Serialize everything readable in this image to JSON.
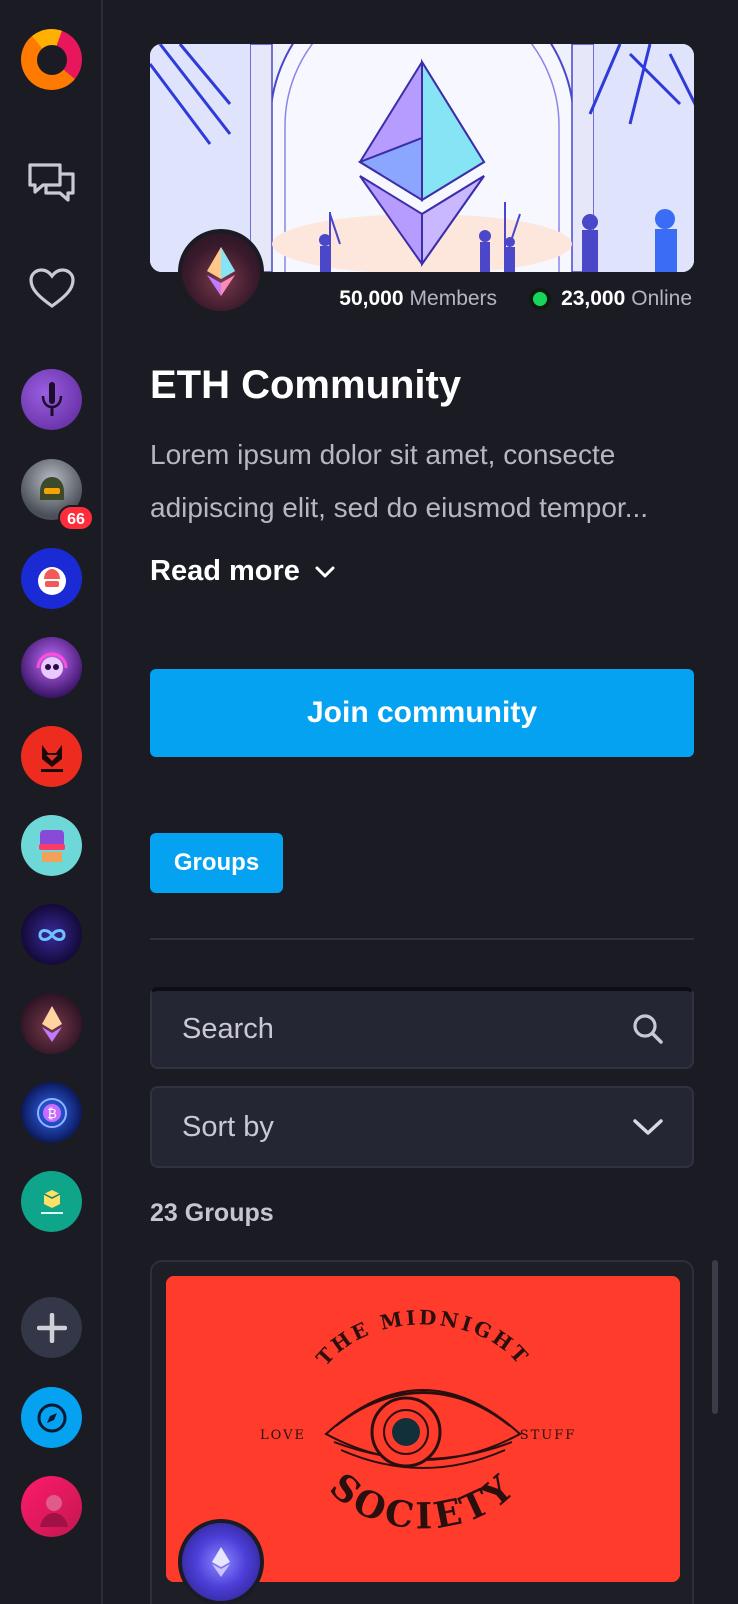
{
  "sidebar": {
    "logo": "app-logo",
    "nav": [
      {
        "name": "chat-icon"
      },
      {
        "name": "heart-icon"
      }
    ],
    "communities": [
      {
        "name": "community-purple-mic",
        "color": "#7a3fc0"
      },
      {
        "name": "community-soldier",
        "color": "#6b6f78",
        "badge": "66"
      },
      {
        "name": "community-fist",
        "color": "#1a2bd6"
      },
      {
        "name": "community-skull-headphones",
        "color": "#5a2a8a"
      },
      {
        "name": "community-foxify",
        "color": "#ee2b1f"
      },
      {
        "name": "community-robot",
        "color": "#4ec7c9"
      },
      {
        "name": "community-infinity",
        "color": "#2a1a6a"
      },
      {
        "name": "community-eth",
        "color": "#3a1a2c"
      },
      {
        "name": "community-bitcoin",
        "color": "#1b2a8a"
      },
      {
        "name": "community-pencilbox",
        "color": "#0fa58a"
      }
    ],
    "add_icon": "plus-icon",
    "explore_icon": "compass-icon"
  },
  "community": {
    "members_count": "50,000",
    "members_label": "Members",
    "online_count": "23,000",
    "online_label": "Online",
    "title": "ETH Community",
    "description": "Lorem ipsum dolor sit amet, consecte adipiscing elit, sed do eiusmod tempor...",
    "read_more": "Read more",
    "join_label": "Join community"
  },
  "tabs": {
    "groups": "Groups"
  },
  "search": {
    "placeholder": "Search"
  },
  "sort": {
    "label": "Sort by"
  },
  "groups": {
    "count_label": "23 Groups",
    "items": [
      {
        "cover_top": "THE MIDNIGHT",
        "cover_left": "LOVE",
        "cover_right": "STUFF",
        "cover_bottom": "SOCIETY"
      }
    ]
  },
  "colors": {
    "accent": "#06a2f2",
    "background": "#1b1c23",
    "online": "#17d45a",
    "badge": "#ff2d3a",
    "cover": "#ff3b2b"
  }
}
